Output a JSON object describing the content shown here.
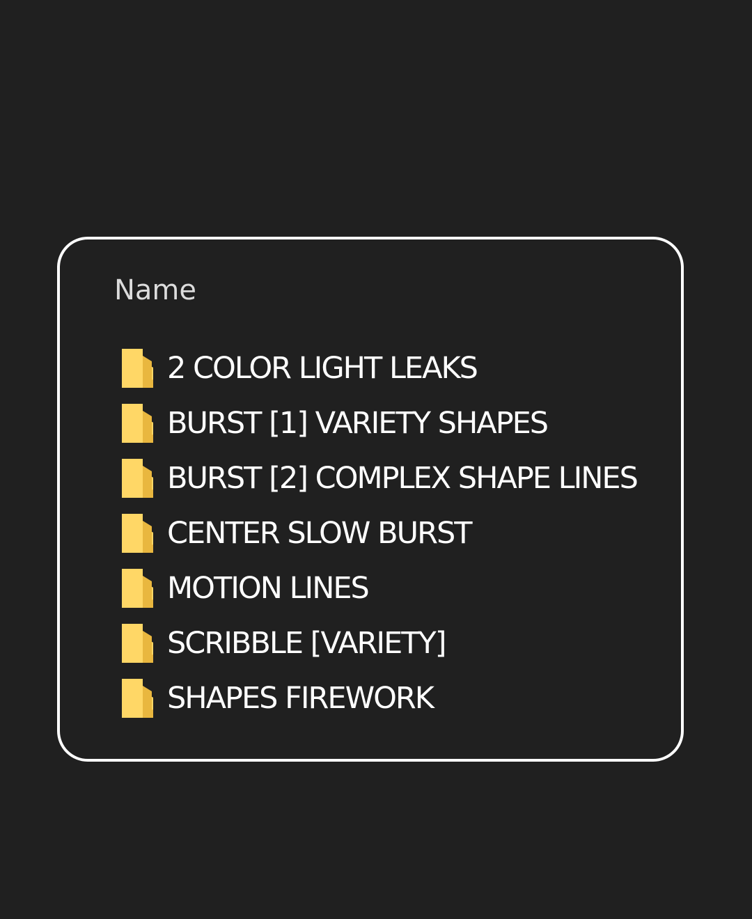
{
  "explorer": {
    "column_header": "Name",
    "folder_color": "#ffd766",
    "folder_shade": "#e9b73f",
    "items": [
      {
        "label": "2 COLOR LIGHT LEAKS",
        "icon": "folder-icon"
      },
      {
        "label": "BURST [1] VARIETY SHAPES",
        "icon": "folder-icon"
      },
      {
        "label": "BURST [2] COMPLEX SHAPE LINES",
        "icon": "folder-icon"
      },
      {
        "label": "CENTER SLOW BURST",
        "icon": "folder-icon"
      },
      {
        "label": "MOTION LINES",
        "icon": "folder-icon"
      },
      {
        "label": "SCRIBBLE [VARIETY]",
        "icon": "folder-icon"
      },
      {
        "label": "SHAPES FIREWORK",
        "icon": "folder-icon"
      }
    ]
  }
}
